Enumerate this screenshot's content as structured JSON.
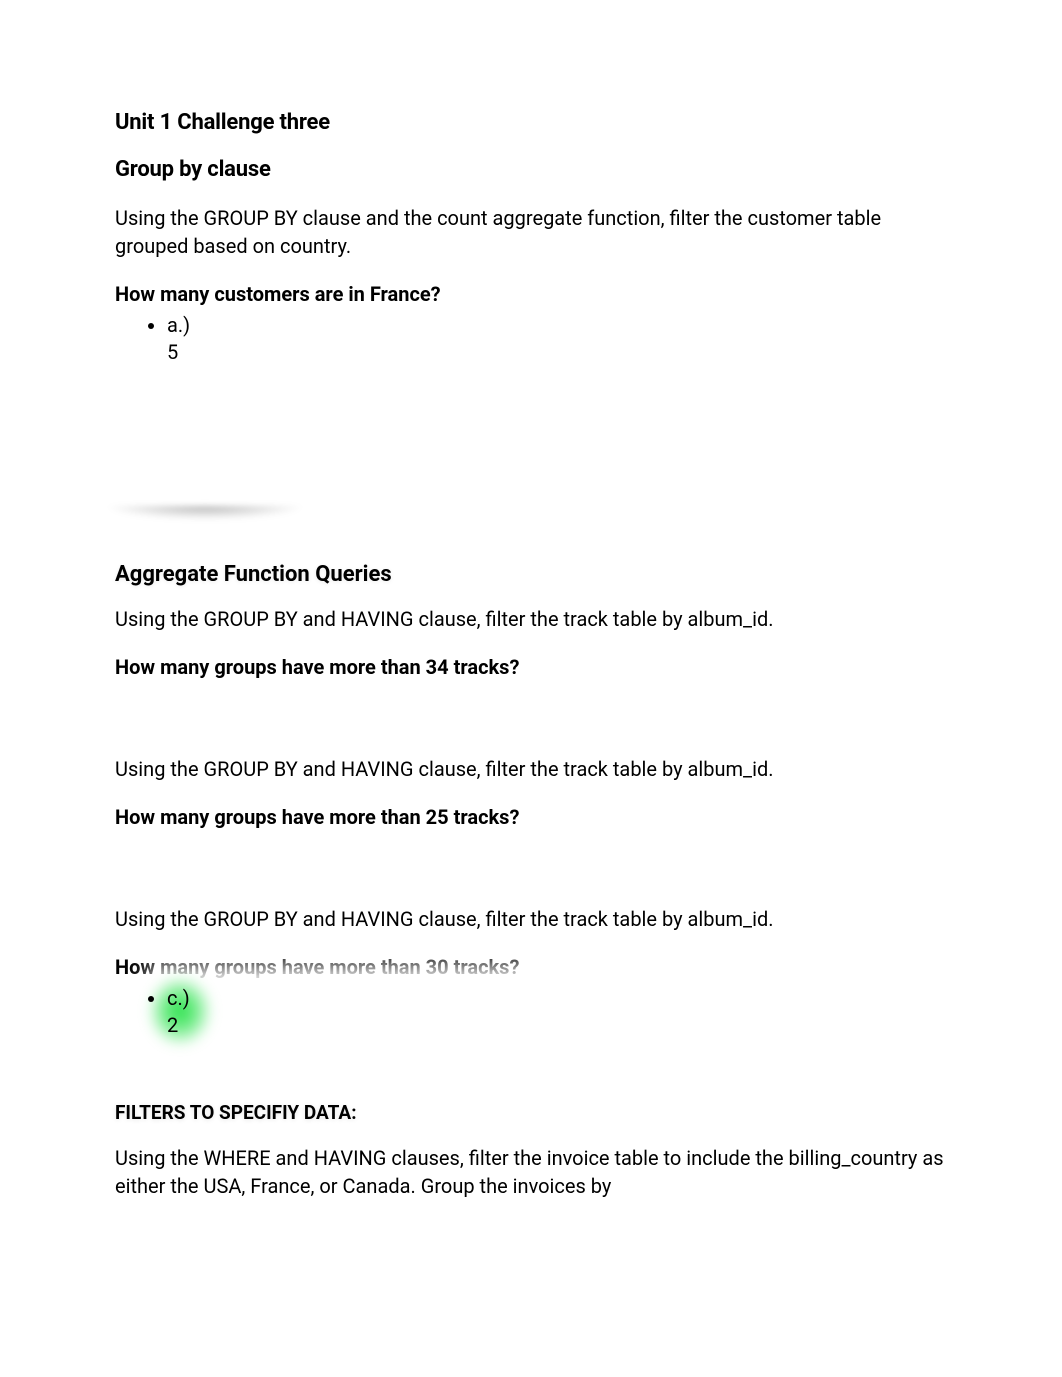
{
  "unit_title": "Unit 1 Challenge three",
  "section1": {
    "title": "Group by clause",
    "intro": "Using the GROUP BY clause and the count aggregate function, filter the customer table grouped based on country.",
    "question": "How many customers are in France?",
    "answer_label": "a.)",
    "answer_value": "5"
  },
  "section2": {
    "title": "Aggregate Function Queries",
    "q1": {
      "intro": "Using the GROUP BY and HAVING clause, filter the track table by album_id.",
      "question": "How many groups have more than 34 tracks?"
    },
    "q2": {
      "intro": "Using the GROUP BY and HAVING clause, filter the track table by album_id.",
      "question": "How many groups have more than 25 tracks?"
    },
    "q3": {
      "intro": "Using the GROUP BY and HAVING clause, filter the track table by album_id.",
      "question": "How many groups have more than 30 tracks?",
      "answer_label": "c.)",
      "answer_value": "2"
    }
  },
  "section3": {
    "title": "FILTERS TO SPECIFIY DATA:",
    "intro": "Using the WHERE and HAVING clauses, filter the invoice table to include the billing_country as either the USA, France, or Canada. Group the invoices by"
  }
}
